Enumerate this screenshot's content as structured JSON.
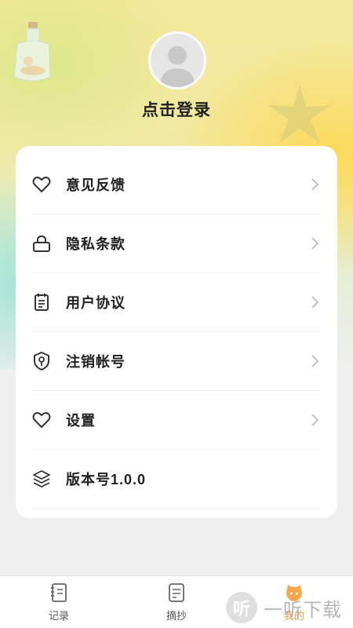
{
  "header": {
    "login_text": "点击登录"
  },
  "menu": {
    "items": [
      {
        "label": "意见反馈",
        "icon": "heart-icon"
      },
      {
        "label": "隐私条款",
        "icon": "lock-icon"
      },
      {
        "label": "用户协议",
        "icon": "clipboard-icon"
      },
      {
        "label": "注销帐号",
        "icon": "shield-key-icon"
      },
      {
        "label": "设置",
        "icon": "heart-icon"
      },
      {
        "label": "版本号1.0.0",
        "icon": "layers-icon"
      }
    ]
  },
  "tabbar": {
    "tabs": [
      {
        "label": "记录",
        "icon": "notebook-icon"
      },
      {
        "label": "摘抄",
        "icon": "document-icon"
      },
      {
        "label": "我的",
        "icon": "cat-face-icon",
        "active": true
      }
    ]
  },
  "watermark": {
    "logo_text": "听",
    "text": "一听下载"
  },
  "colors": {
    "accent": "#f19a3e",
    "text": "#222222",
    "card": "#ffffff",
    "background": "#efefef"
  }
}
